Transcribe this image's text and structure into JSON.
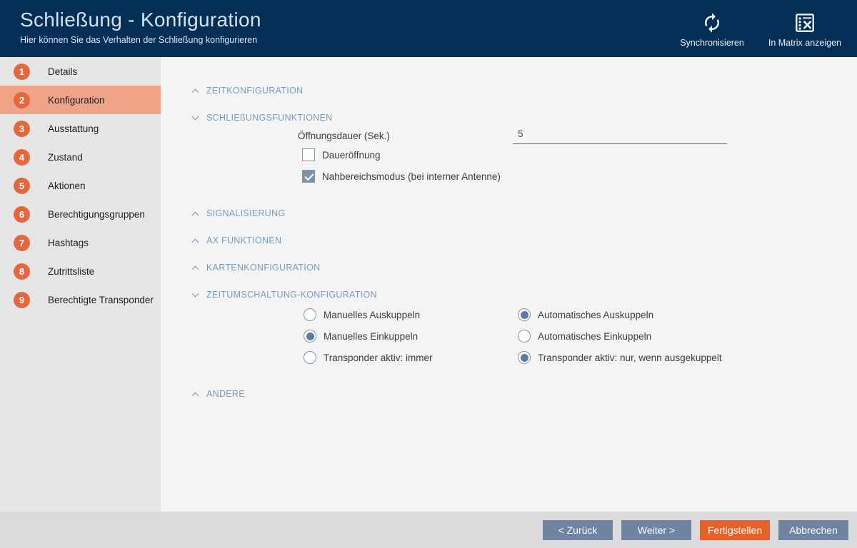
{
  "colors": {
    "header_bg": "#032e55",
    "accent_orange": "#e7663c",
    "active_item_bg": "#efa389",
    "section_header_text": "#7d9bb9",
    "button_blue": "#6d84a3",
    "button_orange": "#e5622a",
    "control_blue": "#7b93ad"
  },
  "header": {
    "title": "Schließung - Konfiguration",
    "subtitle": "Hier können Sie das Verhalten der Schließung konfigurieren",
    "actions": [
      {
        "label": "Synchronisieren",
        "icon": "sync-icon"
      },
      {
        "label": "In Matrix anzeigen",
        "icon": "matrix-icon"
      }
    ]
  },
  "sidebar": {
    "items": [
      {
        "number": "1",
        "label": "Details",
        "active": false
      },
      {
        "number": "2",
        "label": "Konfiguration",
        "active": true
      },
      {
        "number": "3",
        "label": "Ausstattung",
        "active": false
      },
      {
        "number": "4",
        "label": "Zustand",
        "active": false
      },
      {
        "number": "5",
        "label": "Aktionen",
        "active": false
      },
      {
        "number": "6",
        "label": "Berechtigungsgruppen",
        "active": false
      },
      {
        "number": "7",
        "label": "Hashtags",
        "active": false
      },
      {
        "number": "8",
        "label": "Zutrittsliste",
        "active": false
      },
      {
        "number": "9",
        "label": "Berechtigte Transponder",
        "active": false
      }
    ]
  },
  "main": {
    "sections": [
      {
        "label": "ZEITKONFIGURATION",
        "state": "collapsed"
      },
      {
        "label": "SCHLIEßUNGSFUNKTIONEN",
        "state": "expanded"
      },
      {
        "label": "SIGNALISIERUNG",
        "state": "collapsed"
      },
      {
        "label": "AX FUNKTIONEN",
        "state": "collapsed"
      },
      {
        "label": "KARTENKONFIGURATION",
        "state": "collapsed"
      },
      {
        "label": "ZEITUMSCHALTUNG-KONFIGURATION",
        "state": "expanded"
      },
      {
        "label": "ANDERE",
        "state": "collapsed"
      }
    ],
    "schliessungsfunktionen": {
      "oeffnungsdauer_label": "Öffnungsdauer (Sek.)",
      "oeffnungsdauer_value": "5",
      "checkboxes": [
        {
          "label": "Daueröffnung",
          "checked": false
        },
        {
          "label": "Nahbereichsmodus (bei interner Antenne)",
          "checked": true
        }
      ]
    },
    "zeitumschaltung": {
      "left": [
        {
          "label": "Manuelles Auskuppeln",
          "selected": false
        },
        {
          "label": "Manuelles Einkuppeln",
          "selected": true
        },
        {
          "label": "Transponder aktiv: immer",
          "selected": false
        }
      ],
      "right": [
        {
          "label": "Automatisches Auskuppeln",
          "selected": true
        },
        {
          "label": "Automatisches Einkuppeln",
          "selected": false
        },
        {
          "label": "Transponder aktiv: nur, wenn ausgekuppelt",
          "selected": true
        }
      ]
    }
  },
  "footer": {
    "buttons": [
      {
        "label": "< Zurück",
        "style": "default"
      },
      {
        "label": "Weiter >",
        "style": "default"
      },
      {
        "label": "Fertigstellen",
        "style": "primary"
      },
      {
        "label": "Abbrechen",
        "style": "default"
      }
    ]
  }
}
